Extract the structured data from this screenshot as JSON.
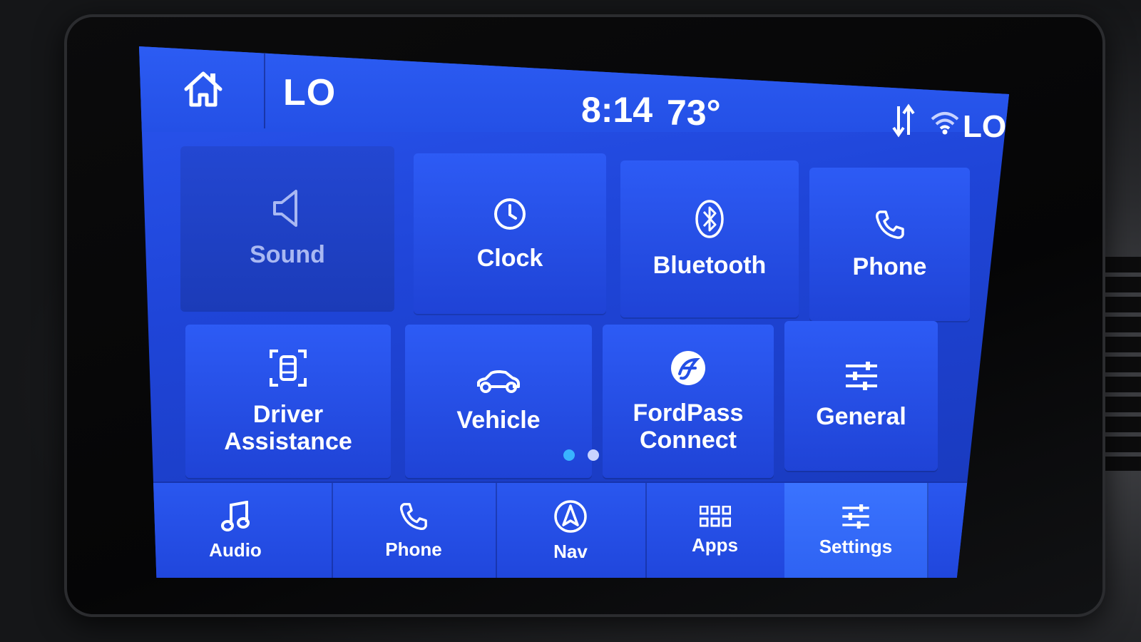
{
  "status_bar": {
    "left_temp": "LO",
    "time": "8:14",
    "outside_temp": "73°",
    "right_temp": "LO",
    "icons": [
      "home-icon",
      "data-transfer-icon",
      "wifi-icon"
    ]
  },
  "settings_tiles": [
    {
      "label": "Sound",
      "icon": "speaker-icon",
      "state": "disabled"
    },
    {
      "label": "Clock",
      "icon": "clock-icon"
    },
    {
      "label": "Bluetooth",
      "icon": "bluetooth-icon"
    },
    {
      "label": "Phone",
      "icon": "phone-icon"
    },
    {
      "label": "Driver\nAssistance",
      "icon": "driver-assist-icon"
    },
    {
      "label": "Vehicle",
      "icon": "car-icon"
    },
    {
      "label": "FordPass\nConnect",
      "icon": "fordpass-icon"
    },
    {
      "label": "General",
      "icon": "sliders-icon"
    }
  ],
  "pagination": {
    "pages": 2,
    "current": 1
  },
  "bottom_nav": [
    {
      "label": "Audio",
      "icon": "music-note-icon"
    },
    {
      "label": "Phone",
      "icon": "phone-icon"
    },
    {
      "label": "Nav",
      "icon": "navigation-icon"
    },
    {
      "label": "Apps",
      "icon": "apps-grid-icon"
    },
    {
      "label": "Settings",
      "icon": "settings-sliders-icon",
      "active": true
    }
  ],
  "colors": {
    "screen_blue": "#2450e6",
    "active_tab": "#3a73ff",
    "active_dot": "#39b4ff",
    "disabled_text": "#a9b8f2"
  }
}
